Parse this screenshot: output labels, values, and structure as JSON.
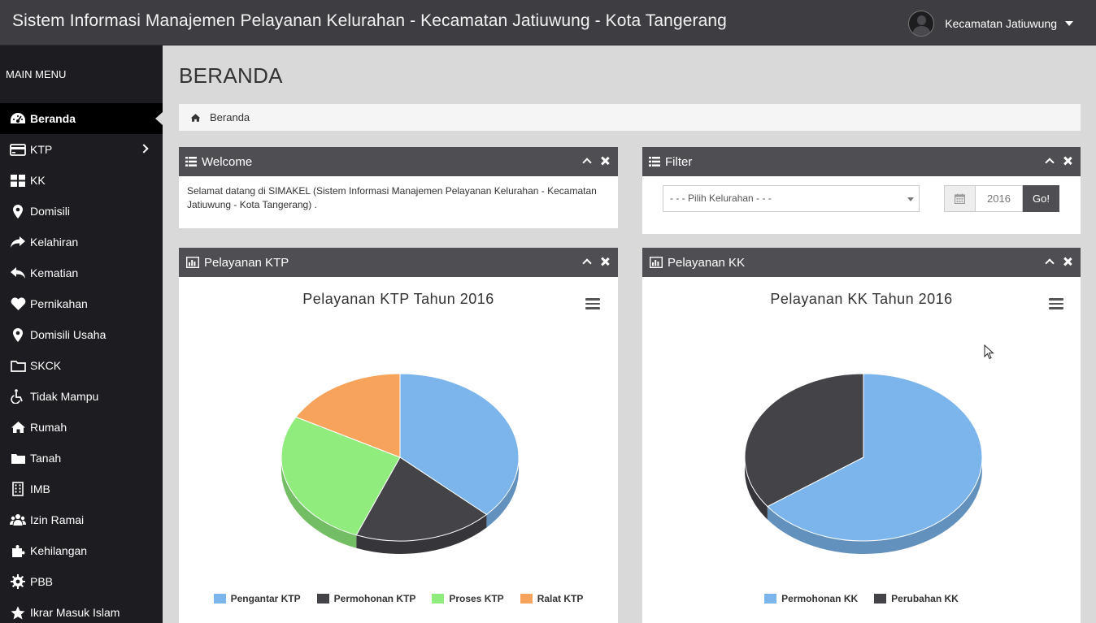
{
  "header": {
    "title": "Sistem Informasi Manajemen Pelayanan Kelurahan - Kecamatan Jatiuwung - Kota Tangerang",
    "user_name": "Kecamatan Jatiuwung"
  },
  "sidebar": {
    "heading": "MAIN MENU",
    "items": [
      {
        "label": "Beranda",
        "icon": "dashboard-icon"
      },
      {
        "label": "KTP",
        "icon": "id-card-icon"
      },
      {
        "label": "KK",
        "icon": "grid-icon"
      },
      {
        "label": "Domisili",
        "icon": "map-marker-icon"
      },
      {
        "label": "Kelahiran",
        "icon": "share-icon"
      },
      {
        "label": "Kematian",
        "icon": "reply-icon"
      },
      {
        "label": "Pernikahan",
        "icon": "heart-icon"
      },
      {
        "label": "Domisili Usaha",
        "icon": "map-marker-icon"
      },
      {
        "label": "SKCK",
        "icon": "folder-open-icon"
      },
      {
        "label": "Tidak Mampu",
        "icon": "wheelchair-icon"
      },
      {
        "label": "Rumah",
        "icon": "home-icon"
      },
      {
        "label": "Tanah",
        "icon": "folder-icon"
      },
      {
        "label": "IMB",
        "icon": "building-icon"
      },
      {
        "label": "Izin Ramai",
        "icon": "users-icon"
      },
      {
        "label": "Kehilangan",
        "icon": "puzzle-icon"
      },
      {
        "label": "PBB",
        "icon": "cog-icon"
      },
      {
        "label": "Ikrar Masuk Islam",
        "icon": "star-icon"
      }
    ]
  },
  "page": {
    "title": "BERANDA",
    "breadcrumb": "Beranda"
  },
  "welcome": {
    "title": "Welcome",
    "text": "Selamat datang di SIMAKEL (Sistem Informasi Manajemen Pelayanan Kelurahan - Kecamatan Jatiuwung - Kota Tangerang) ."
  },
  "filter": {
    "title": "Filter",
    "select_value": "- - - Pilih Kelurahan - - -",
    "year": "2016",
    "go_label": "Go!"
  },
  "ktp_panel": {
    "title": "Pelayanan KTP"
  },
  "kk_panel": {
    "title": "Pelayanan KK"
  },
  "colors": {
    "blue": "#7cb5ec",
    "dark": "#434348",
    "green": "#90ed7d",
    "orange": "#f7a35c"
  },
  "chart_data": [
    {
      "type": "pie",
      "title": "Pelayanan KTP Tahun 2016",
      "series": [
        {
          "name": "Pengantar KTP",
          "value": 37,
          "color": "#7cb5ec"
        },
        {
          "name": "Permohonan KTP",
          "value": 19,
          "color": "#434348"
        },
        {
          "name": "Proses KTP",
          "value": 27,
          "color": "#90ed7d"
        },
        {
          "name": "Ralat KTP",
          "value": 17,
          "color": "#f7a35c"
        }
      ]
    },
    {
      "type": "pie",
      "title": "Pelayanan KK Tahun 2016",
      "series": [
        {
          "name": "Permohonan KK",
          "value": 65,
          "color": "#7cb5ec"
        },
        {
          "name": "Perubahan KK",
          "value": 35,
          "color": "#434348"
        }
      ]
    }
  ]
}
